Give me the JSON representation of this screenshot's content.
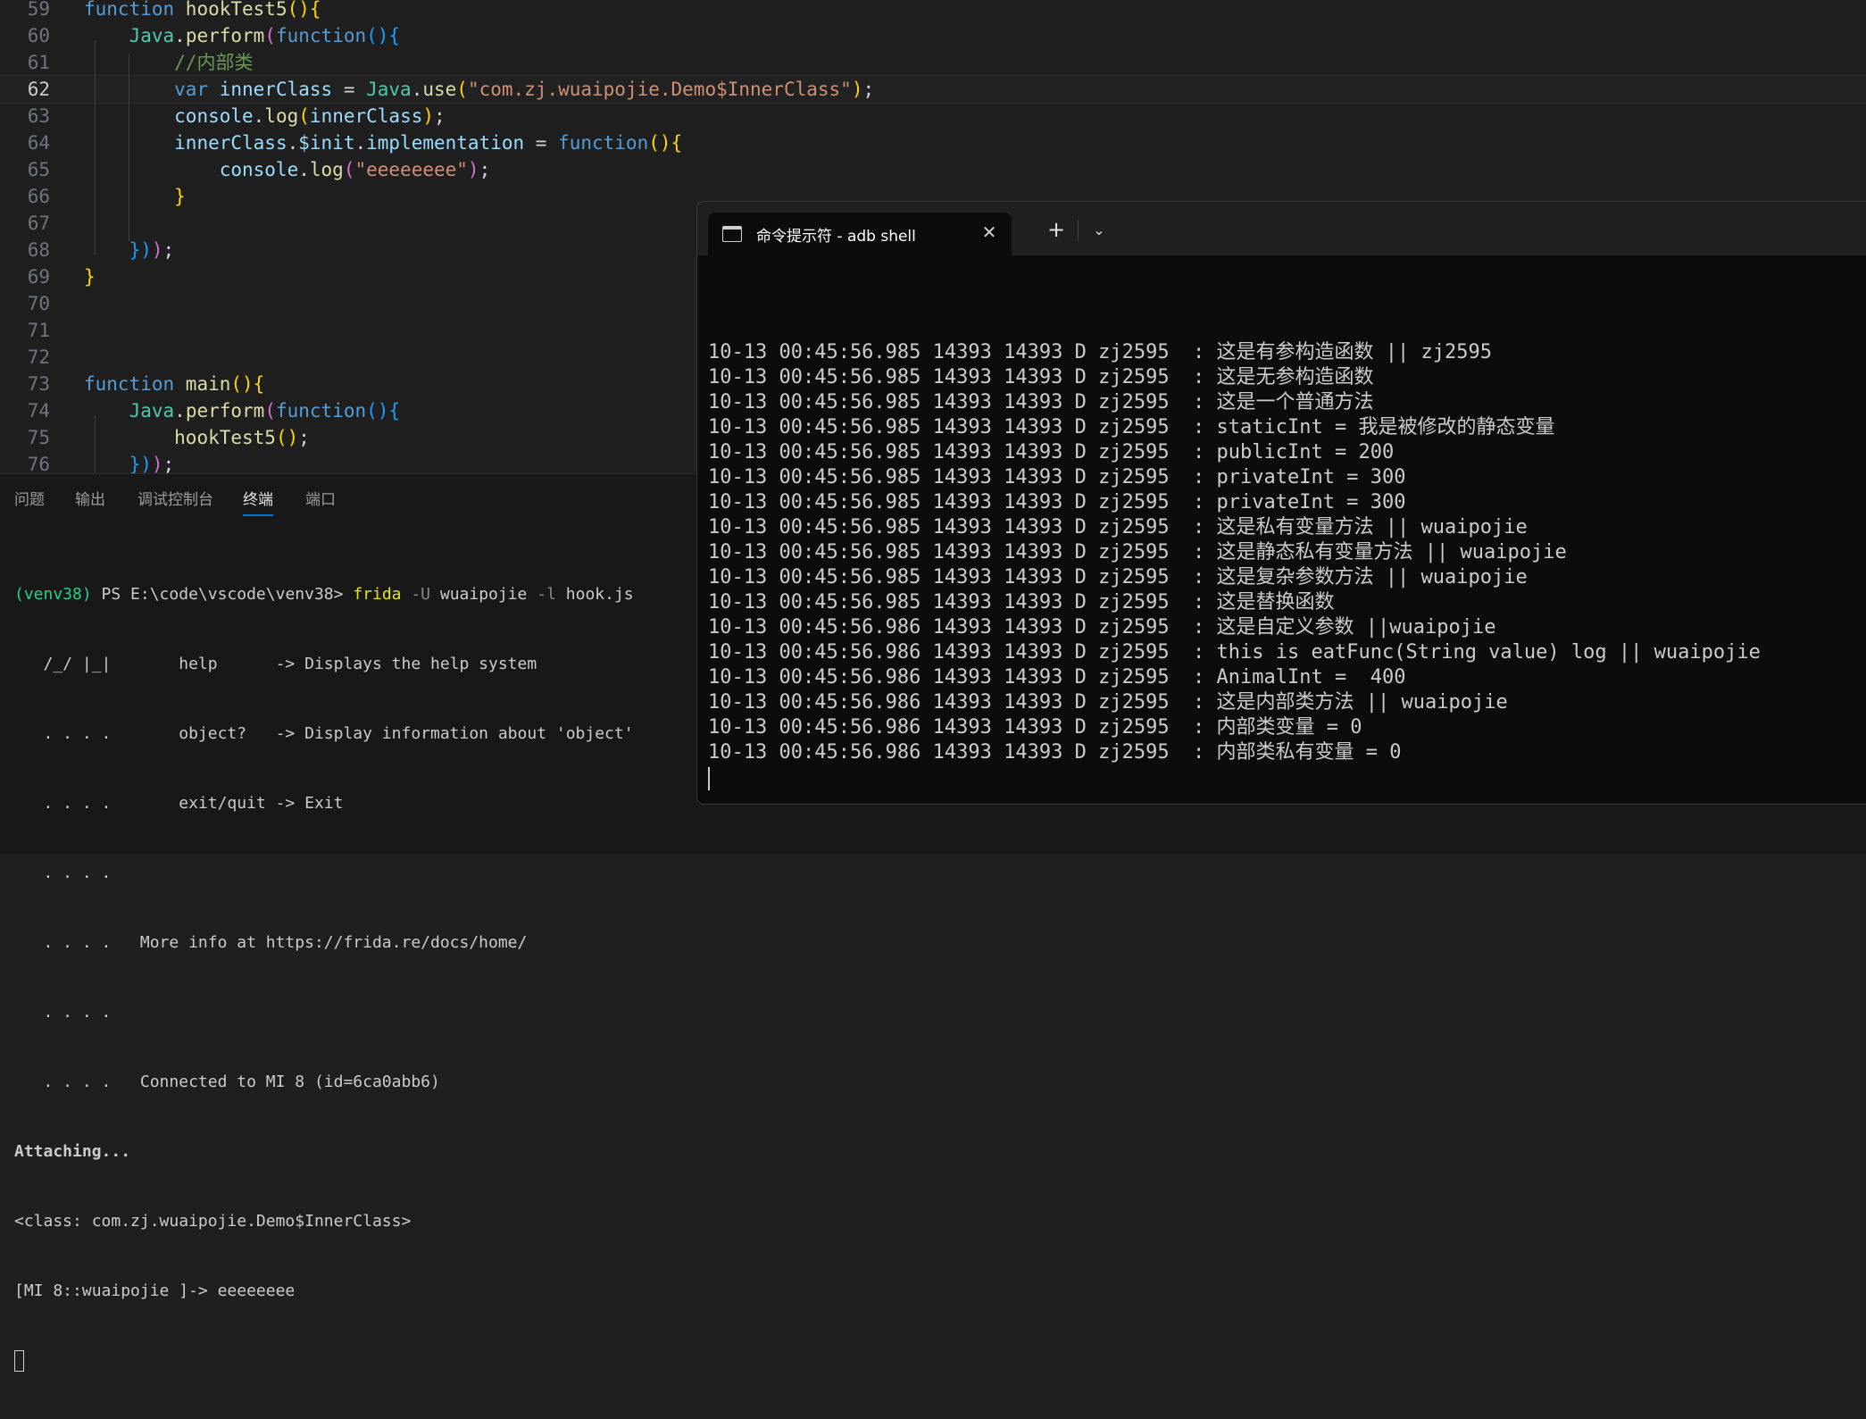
{
  "editor": {
    "lines": [
      {
        "n": "59",
        "tokens": [
          [
            "kw",
            "function "
          ],
          [
            "fn",
            "hookTest5"
          ],
          [
            "b1",
            "(){"
          ]
        ]
      },
      {
        "n": "60",
        "tokens": [
          [
            "sp",
            "    "
          ],
          [
            "cls",
            "Java"
          ],
          [
            "p",
            "."
          ],
          [
            "fn",
            "perform"
          ],
          [
            "b2",
            "("
          ],
          [
            "kw",
            "function"
          ],
          [
            "b3",
            "(){"
          ]
        ]
      },
      {
        "n": "61",
        "tokens": [
          [
            "sp",
            "        "
          ],
          [
            "cm",
            "//内部类"
          ]
        ]
      },
      {
        "n": "62",
        "active": true,
        "tokens": [
          [
            "sp",
            "        "
          ],
          [
            "kw",
            "var "
          ],
          [
            "var",
            "innerClass"
          ],
          [
            "p",
            " = "
          ],
          [
            "cls",
            "Java"
          ],
          [
            "p",
            "."
          ],
          [
            "fn",
            "use"
          ],
          [
            "b1",
            "("
          ],
          [
            "str",
            "\"com.zj.wuaipojie.Demo$InnerClass\""
          ],
          [
            "b1",
            ")"
          ],
          [
            "p",
            ";"
          ]
        ]
      },
      {
        "n": "63",
        "tokens": [
          [
            "sp",
            "        "
          ],
          [
            "var",
            "console"
          ],
          [
            "p",
            "."
          ],
          [
            "fn",
            "log"
          ],
          [
            "b1",
            "("
          ],
          [
            "var",
            "innerClass"
          ],
          [
            "b1",
            ")"
          ],
          [
            "p",
            ";"
          ]
        ]
      },
      {
        "n": "64",
        "tokens": [
          [
            "sp",
            "        "
          ],
          [
            "var",
            "innerClass"
          ],
          [
            "p",
            "."
          ],
          [
            "var",
            "$init"
          ],
          [
            "p",
            "."
          ],
          [
            "var",
            "implementation"
          ],
          [
            "p",
            " = "
          ],
          [
            "kw",
            "function"
          ],
          [
            "b1",
            "(){"
          ]
        ]
      },
      {
        "n": "65",
        "tokens": [
          [
            "sp",
            "            "
          ],
          [
            "var",
            "console"
          ],
          [
            "p",
            "."
          ],
          [
            "fn",
            "log"
          ],
          [
            "b2",
            "("
          ],
          [
            "str",
            "\"eeeeeeee\""
          ],
          [
            "b2",
            ")"
          ],
          [
            "p",
            ";"
          ]
        ]
      },
      {
        "n": "66",
        "tokens": [
          [
            "sp",
            "        "
          ],
          [
            "b1",
            "}"
          ]
        ]
      },
      {
        "n": "67",
        "tokens": []
      },
      {
        "n": "68",
        "tokens": [
          [
            "sp",
            "    "
          ],
          [
            "b3",
            "})"
          ],
          [
            "b2",
            ")"
          ],
          [
            "p",
            ";"
          ]
        ]
      },
      {
        "n": "69",
        "tokens": [
          [
            "b1",
            "}"
          ]
        ]
      },
      {
        "n": "70",
        "tokens": []
      },
      {
        "n": "71",
        "tokens": []
      },
      {
        "n": "72",
        "tokens": []
      },
      {
        "n": "73",
        "tokens": [
          [
            "kw",
            "function "
          ],
          [
            "fn",
            "main"
          ],
          [
            "b1",
            "(){"
          ]
        ]
      },
      {
        "n": "74",
        "tokens": [
          [
            "sp",
            "    "
          ],
          [
            "cls",
            "Java"
          ],
          [
            "p",
            "."
          ],
          [
            "fn",
            "perform"
          ],
          [
            "b2",
            "("
          ],
          [
            "kw",
            "function"
          ],
          [
            "b3",
            "(){"
          ]
        ]
      },
      {
        "n": "75",
        "tokens": [
          [
            "sp",
            "        "
          ],
          [
            "fn",
            "hookTest5"
          ],
          [
            "b1",
            "()"
          ],
          [
            "p",
            ";"
          ]
        ]
      },
      {
        "n": "76",
        "tokens": [
          [
            "sp",
            "    "
          ],
          [
            "b3",
            "})"
          ],
          [
            "b2",
            ")"
          ],
          [
            "p",
            ";"
          ]
        ]
      }
    ]
  },
  "panel": {
    "tabs": [
      {
        "label": "问题",
        "active": false
      },
      {
        "label": "输出",
        "active": false
      },
      {
        "label": "调试控制台",
        "active": false
      },
      {
        "label": "终端",
        "active": true
      },
      {
        "label": "端口",
        "active": false
      }
    ],
    "terminal": {
      "prompt": {
        "env": "(venv38)",
        "ps": " PS E:\\code\\vscode\\venv38> ",
        "cmd": "frida",
        "f1": " -U ",
        "arg": "wuaipojie",
        "f2": " -l ",
        "file": "hook.js"
      },
      "lines": [
        "   /_/ |_|       help      -> Displays the help system",
        "   . . . .       object?   -> Display information about 'object'",
        "   . . . .       exit/quit -> Exit",
        "   . . . .",
        "   . . . .   More info at https://frida.re/docs/home/",
        "   . . . .",
        "   . . . .   Connected to MI 8 (id=6ca0abb6)"
      ],
      "attaching": "Attaching...",
      "class_line": "<class: com.zj.wuaipojie.Demo$InnerClass>",
      "repl_line": "[MI 8::wuaipojie ]-> eeeeeeee"
    }
  },
  "cmd": {
    "tab_title": "命令提示符 - adb  shell",
    "close_glyph": "✕",
    "new_tab_glyph": "+",
    "dropdown_glyph": "⌄",
    "icons": [
      "console-icon",
      "close-icon",
      "plus-icon",
      "chevron-down-icon"
    ],
    "log": [
      "10-13 00:45:56.985 14393 14393 D zj2595  : 这是有参构造函数 || zj2595",
      "10-13 00:45:56.985 14393 14393 D zj2595  : 这是无参构造函数",
      "10-13 00:45:56.985 14393 14393 D zj2595  : 这是一个普通方法",
      "10-13 00:45:56.985 14393 14393 D zj2595  : staticInt = 我是被修改的静态变量",
      "10-13 00:45:56.985 14393 14393 D zj2595  : publicInt = 200",
      "10-13 00:45:56.985 14393 14393 D zj2595  : privateInt = 300",
      "10-13 00:45:56.985 14393 14393 D zj2595  : privateInt = 300",
      "10-13 00:45:56.985 14393 14393 D zj2595  : 这是私有变量方法 || wuaipojie",
      "10-13 00:45:56.985 14393 14393 D zj2595  : 这是静态私有变量方法 || wuaipojie",
      "10-13 00:45:56.985 14393 14393 D zj2595  : 这是复杂参数方法 || wuaipojie",
      "10-13 00:45:56.985 14393 14393 D zj2595  : 这是替换函数",
      "10-13 00:45:56.986 14393 14393 D zj2595  : 这是自定义参数 ||wuaipojie",
      "10-13 00:45:56.986 14393 14393 D zj2595  : this is eatFunc(String value) log || wuaipojie",
      "10-13 00:45:56.986 14393 14393 D zj2595  : AnimalInt =  400",
      "10-13 00:45:56.986 14393 14393 D zj2595  : 这是内部类方法 || wuaipojie",
      "10-13 00:45:56.986 14393 14393 D zj2595  : 内部类变量 = 0",
      "10-13 00:45:56.986 14393 14393 D zj2595  : 内部类私有变量 = 0"
    ]
  }
}
